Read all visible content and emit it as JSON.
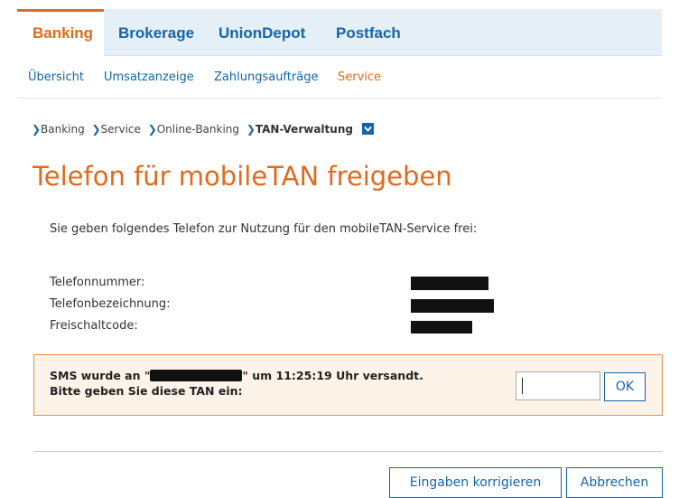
{
  "top_nav": {
    "tabs": [
      {
        "label": "Banking"
      },
      {
        "label": "Brokerage"
      },
      {
        "label": "UnionDepot"
      },
      {
        "label": "Postfach"
      }
    ]
  },
  "sub_nav": {
    "items": [
      {
        "label": "Übersicht"
      },
      {
        "label": "Umsatzanzeige"
      },
      {
        "label": "Zahlungsaufträge"
      },
      {
        "label": "Service"
      }
    ]
  },
  "breadcrumb": {
    "items": [
      "Banking",
      "Service",
      "Online-Banking"
    ],
    "current": "TAN-Verwaltung"
  },
  "page": {
    "title": "Telefon für mobileTAN freigeben",
    "intro": "Sie geben folgendes Telefon zur Nutzung für den mobileTAN-Service frei:"
  },
  "details": {
    "phone_number_label": "Telefonnummer:",
    "phone_name_label": "Telefonbezeichnung:",
    "activation_code_label": "Freischaltcode:"
  },
  "tan": {
    "sms_prefix": "SMS wurde an \"",
    "sms_suffix": "\" um 11:25:19 Uhr versandt.",
    "instruction": "Bitte geben Sie diese TAN ein:",
    "input_value": "",
    "ok_label": "OK"
  },
  "actions": {
    "correct_label": "Eingaben korrigieren",
    "cancel_label": "Abbrechen"
  },
  "colors": {
    "accent_orange": "#e06a1d",
    "link_blue": "#1565a8",
    "nav_bg": "#e4eff8",
    "tan_box_bg": "#fdf3e9"
  }
}
